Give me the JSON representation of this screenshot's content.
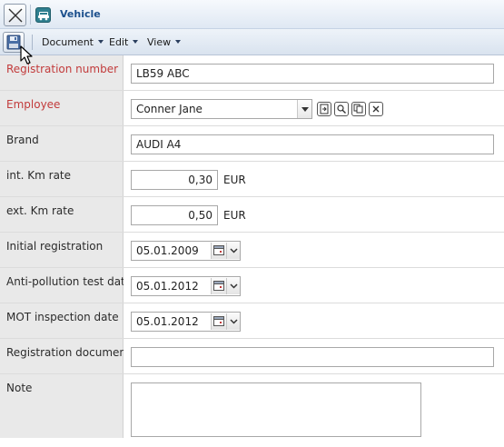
{
  "window": {
    "title": "Vehicle",
    "icon": "vehicle-icon"
  },
  "toolbar": {
    "save_icon": "save-icon",
    "menus": [
      {
        "label": "Document"
      },
      {
        "label": "Edit"
      },
      {
        "label": "View"
      }
    ]
  },
  "form": {
    "registration_number": {
      "label": "Registration number",
      "value": "LB59 ABC",
      "required": true
    },
    "employee": {
      "label": "Employee",
      "value": "Conner Jane",
      "required": true
    },
    "brand": {
      "label": "Brand",
      "value": "AUDI A4"
    },
    "int_km_rate": {
      "label": "int. Km rate",
      "value": "0,30",
      "unit": "EUR"
    },
    "ext_km_rate": {
      "label": "ext. Km rate",
      "value": "0,50",
      "unit": "EUR"
    },
    "initial_registration": {
      "label": "Initial registration",
      "value": "05.01.2009"
    },
    "anti_pollution_test_date": {
      "label": "Anti-pollution test date",
      "value": "05.01.2012"
    },
    "mot_inspection_date": {
      "label": "MOT inspection date",
      "value": "05.01.2012"
    },
    "registration_document": {
      "label": "Registration document",
      "value": ""
    },
    "note": {
      "label": "Note",
      "value": ""
    }
  },
  "colors": {
    "required_label": "#c23b3b",
    "title_text": "#1b4f8c",
    "label_background": "#e9e9e9"
  }
}
